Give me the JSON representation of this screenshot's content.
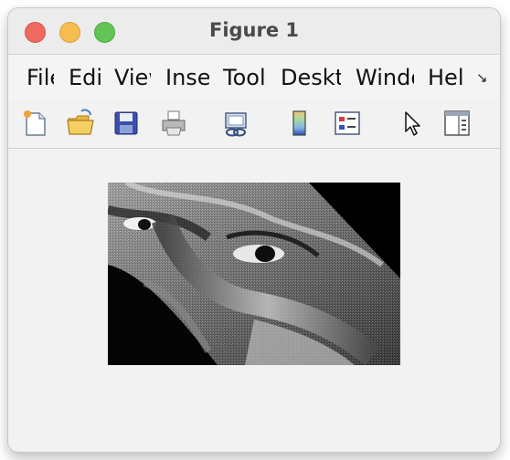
{
  "window": {
    "title": "Figure 1"
  },
  "menubar": {
    "items": [
      {
        "label": "File"
      },
      {
        "label": "Edit"
      },
      {
        "label": "View"
      },
      {
        "label": "Insert"
      },
      {
        "label": "Tools"
      },
      {
        "label": "Desktop"
      },
      {
        "label": "Window"
      },
      {
        "label": "Help"
      }
    ],
    "overflow_icon": "overflow-arrow-icon"
  },
  "toolbar": {
    "tools": [
      {
        "name": "new-figure",
        "icon": "new-document-icon"
      },
      {
        "name": "open-file",
        "icon": "open-folder-icon"
      },
      {
        "name": "save",
        "icon": "save-disk-icon"
      },
      {
        "name": "print",
        "icon": "printer-icon"
      },
      {
        "name": "link-plot",
        "icon": "link-plot-icon"
      },
      {
        "name": "insert-colorbar",
        "icon": "colorbar-icon"
      },
      {
        "name": "insert-legend",
        "icon": "legend-icon"
      },
      {
        "name": "edit-plot",
        "icon": "pointer-arrow-icon"
      },
      {
        "name": "property-inspector",
        "icon": "panel-icon"
      }
    ]
  },
  "figure": {
    "content": "grayscale image of a face, sheared/rotated with black fill",
    "colormap": "gray"
  }
}
